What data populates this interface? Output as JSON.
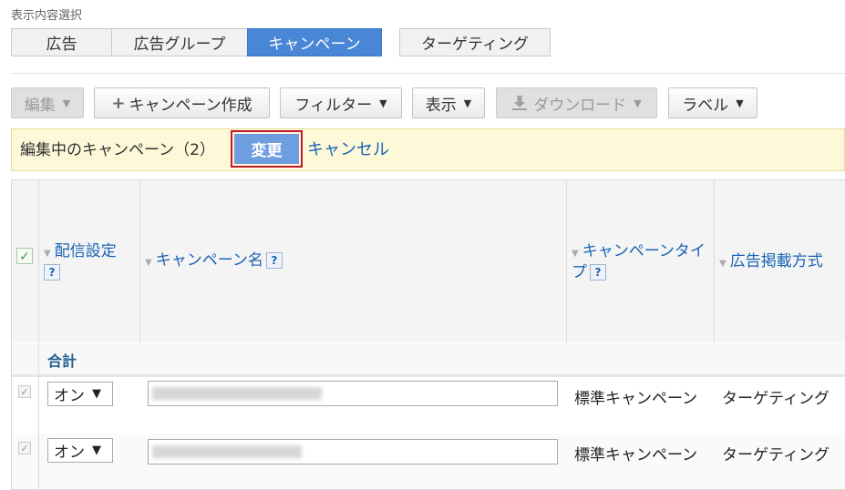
{
  "section_label": "表示内容選択",
  "view_tabs": [
    {
      "label": "広告"
    },
    {
      "label": "広告グループ"
    },
    {
      "label": "キャンペーン"
    },
    {
      "label": "ターゲティング"
    }
  ],
  "toolbar": {
    "edit": "編集",
    "create": "キャンペーン作成",
    "filter": "フィルター",
    "display": "表示",
    "download": "ダウンロード",
    "label": "ラベル"
  },
  "edit_bar": {
    "text": "編集中のキャンペーン（2）",
    "change": "変更",
    "cancel": "キャンセル"
  },
  "table": {
    "headers": {
      "delivery": "配信設定",
      "name": "キャンペーン名",
      "type": "キャンペーンタイプ",
      "placement": "広告掲載方式"
    },
    "help": "?",
    "total_label": "合計",
    "rows": [
      {
        "status": "オン",
        "type": "標準キャンペーン",
        "placement": "ターゲティング"
      },
      {
        "status": "オン",
        "type": "標準キャンペーン",
        "placement": "ターゲティング"
      }
    ]
  },
  "colors": {
    "accent": "#4a86d6",
    "link": "#1a63b5",
    "highlight_border": "#c3172e",
    "edit_bar_bg": "#fdf8d8"
  }
}
